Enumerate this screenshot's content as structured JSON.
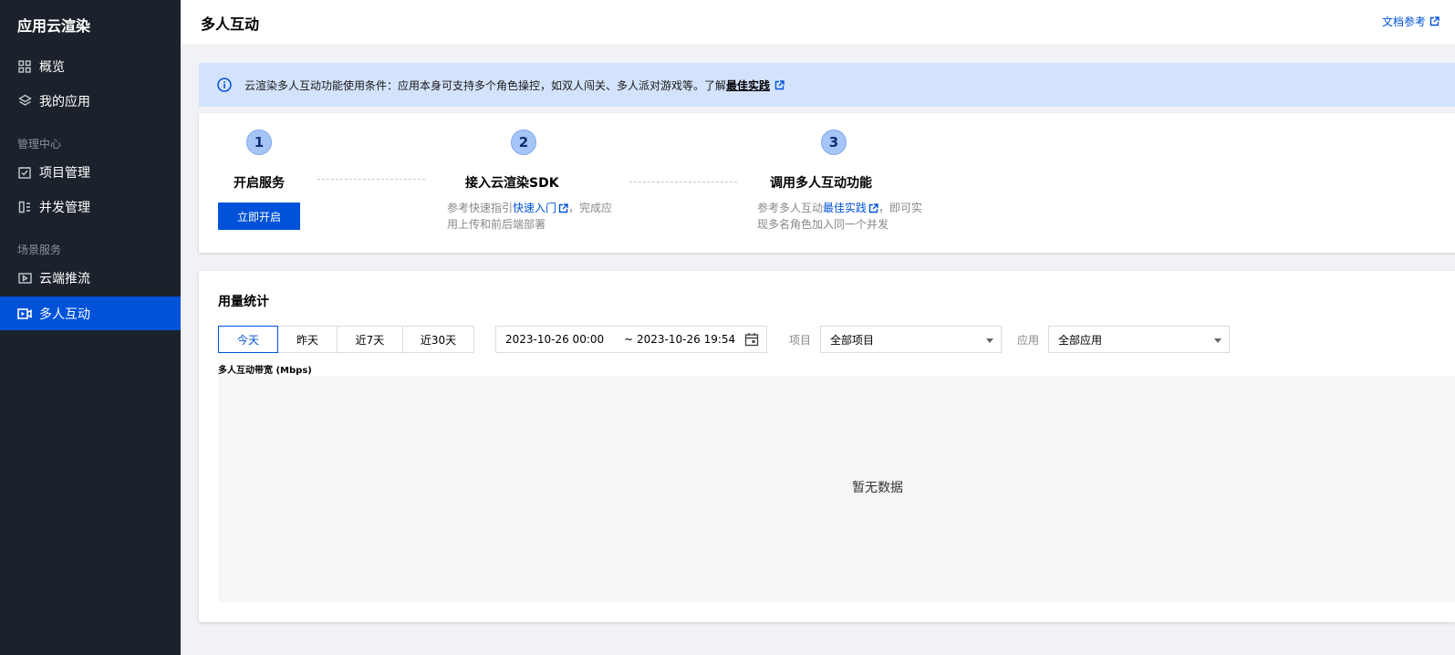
{
  "sidebar": {
    "brand": "应用云渲染",
    "items": [
      {
        "label": "概览",
        "icon": "grid-icon"
      },
      {
        "label": "我的应用",
        "icon": "layers-icon"
      }
    ],
    "group_manage": "管理中心",
    "manage_items": [
      {
        "label": "项目管理",
        "icon": "checkbox-icon"
      },
      {
        "label": "并发管理",
        "icon": "list-icon"
      }
    ],
    "group_scene": "场景服务",
    "scene_items": [
      {
        "label": "云端推流",
        "icon": "video-icon"
      },
      {
        "label": "多人互动",
        "icon": "video-icon",
        "active": true
      }
    ]
  },
  "header": {
    "title": "多人互动",
    "doc_link": "文档参考"
  },
  "notice": {
    "text": "云渲染多人互动功能使用条件：应用本身可支持多个角色操控，如双人闯关、多人派对游戏等。了解",
    "link": "最佳实践"
  },
  "steps": [
    {
      "num": "1",
      "title": "开启服务",
      "button": "立即开启"
    },
    {
      "num": "2",
      "title": "接入云渲染SDK",
      "desc_pre": "参考快速指引",
      "desc_link": "快速入门",
      "desc_post": "，完成应用上传和前后端部署"
    },
    {
      "num": "3",
      "title": "调用多人互动功能",
      "desc_pre": "参考多人互动",
      "desc_link": "最佳实践",
      "desc_post": "，即可实现多名角色加入同一个并发"
    }
  ],
  "usage": {
    "title": "用量统计",
    "ranges": [
      "今天",
      "昨天",
      "近7天",
      "近30天"
    ],
    "active_range": "今天",
    "date_start": "2023-10-26 00:00",
    "date_end": "~ 2023-10-26 19:54",
    "project_label": "项目",
    "project_value": "全部项目",
    "app_label": "应用",
    "app_value": "全部应用",
    "chart_label": "多人互动带宽 (Mbps)",
    "empty_text": "暂无数据"
  },
  "colors": {
    "accent": "#0052d9",
    "sidebar_bg": "#1c222b",
    "notice_bg": "#d4e3fc"
  }
}
